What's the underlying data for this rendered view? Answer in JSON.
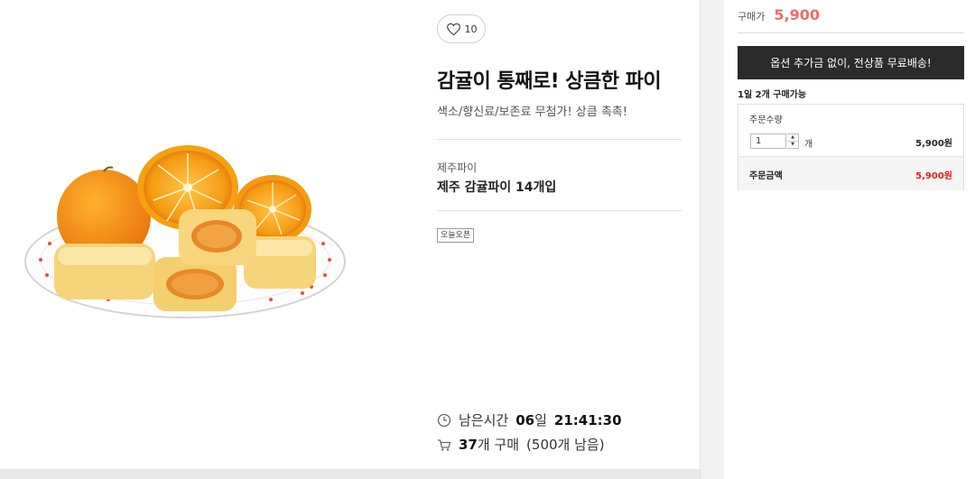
{
  "product": {
    "like_count": "10",
    "title": "감귤이 통째로! 상큼한 파이",
    "subtitle": "색소/향신료/보존료 무첨가! 상큼 촉촉!",
    "brand": "제주파이",
    "name": "제주 감귤파이 14개입",
    "tag": "오늘오픈"
  },
  "deal": {
    "time_prefix": "남은시간",
    "days": "06",
    "days_unit": "일",
    "time": "21:41:30",
    "purchase_count": "37",
    "purchase_suffix": "개 구매",
    "remaining": "(500개 남음)"
  },
  "panel": {
    "price_label": "구매가",
    "price_value": "5,900",
    "shipping_banner": "옵션 추가금 없이, 전상품 무료배송!",
    "limit_text": "1일 2개 구매가능",
    "qty_label": "주문수량",
    "qty_value": "1",
    "qty_unit": "개",
    "line_price": "5,900원",
    "total_label": "주문금액",
    "total_value": "5,900원"
  },
  "colors": {
    "price": "#f06a6a",
    "total": "#e02020",
    "banner": "#2b2b2b"
  }
}
